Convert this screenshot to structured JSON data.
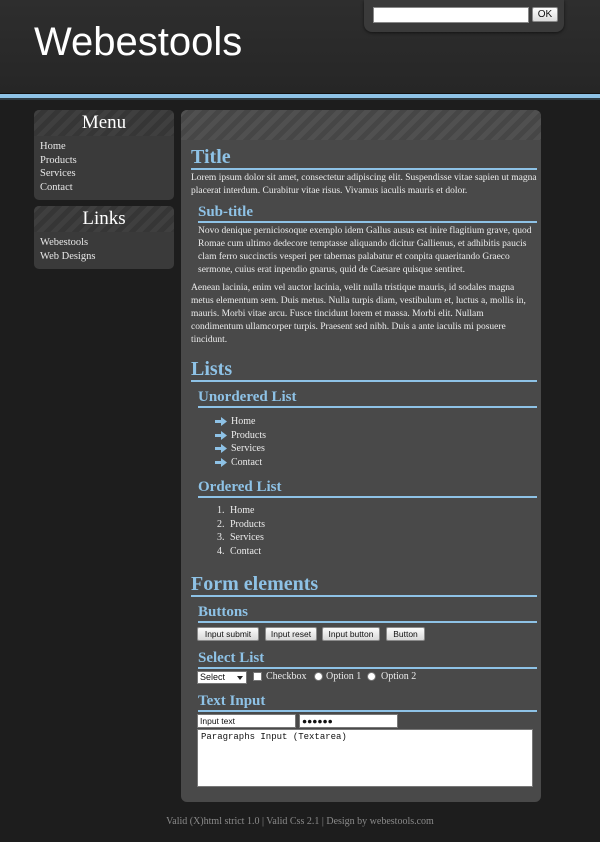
{
  "header": {
    "site_title": "Webestools",
    "search": {
      "value": "",
      "button_label": "OK"
    }
  },
  "sidebar": {
    "menu": {
      "title": "Menu",
      "items": [
        "Home",
        "Products",
        "Services",
        "Contact"
      ]
    },
    "links": {
      "title": "Links",
      "items": [
        "Webestools",
        "Web Designs"
      ]
    }
  },
  "main": {
    "title": "Title",
    "intro": "Lorem ipsum dolor sit amet, consectetur adipiscing elit. Suspendisse vitae sapien ut magna placerat interdum. Curabitur vitae risus. Vivamus iaculis mauris et dolor.",
    "subtitle": "Sub-title",
    "sub_para": "Novo denique perniciosoque exemplo idem Gallus ausus est inire flagitium grave, quod Romae cum ultimo dedecore temptasse aliquando dicitur Gallienus, et adhibitis paucis clam ferro succinctis vesperi per tabernas palabatur et conpita quaeritando Graeco sermone, cuius erat inpendio gnarus, quid de Caesare quisque sentiret.",
    "para2": "Aenean lacinia, enim vel auctor lacinia, velit nulla tristique mauris, id sodales magna metus elementum sem. Duis metus. Nulla turpis diam, vestibulum et, luctus a, mollis in, mauris. Morbi vitae arcu. Fusce tincidunt lorem et massa. Morbi elit. Nullam condimentum ullamcorper turpis. Praesent sed nibh. Duis a ante iaculis mi posuere tincidunt.",
    "lists_heading": "Lists",
    "unordered_heading": "Unordered List",
    "unordered_items": [
      "Home",
      "Products",
      "Services",
      "Contact"
    ],
    "ordered_heading": "Ordered List",
    "ordered_items": [
      "Home",
      "Products",
      "Services",
      "Contact"
    ],
    "form_heading": "Form elements",
    "buttons_heading": "Buttons",
    "buttons": {
      "submit": "Input submit",
      "reset": "Input reset",
      "button": "Input button",
      "plain": "Button"
    },
    "select_heading": "Select List",
    "select_value": "Select",
    "checkbox_label": "Checkbox",
    "option1_label": "Option 1",
    "option2_label": "Option 2",
    "text_input_heading": "Text Input",
    "text_input_value": "Input text",
    "password_value": "●●●●●●",
    "textarea_value": "Paragraphs Input (Textarea)"
  },
  "footer": {
    "text": "Valid (X)html strict 1.0 | Valid Css 2.1 | Design by webestools.com"
  },
  "colors": {
    "accent": "#8ec2e6",
    "background": "#1d1d1d",
    "panel": "#494949",
    "sidebar_panel": "#3a3a3a"
  }
}
